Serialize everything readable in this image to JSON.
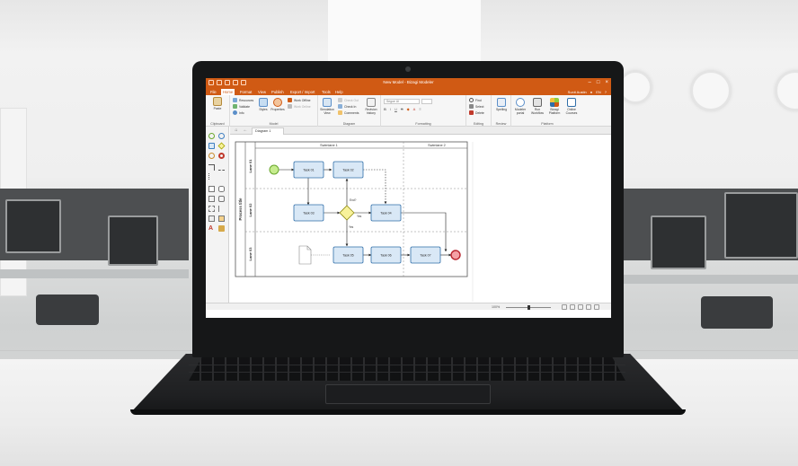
{
  "window": {
    "title": "New Model - Bizagi Modeler"
  },
  "menu": {
    "items": [
      "File",
      "Home",
      "Format",
      "View",
      "Publish",
      "Export / Import",
      "Tools",
      "Help"
    ],
    "active": "Home",
    "user": "Sunit Austin",
    "lang": "EN"
  },
  "ribbon": {
    "clipboard": {
      "paste": "Paste",
      "label": "Clipboard"
    },
    "model": {
      "resources": "Resources",
      "validate": "Validate",
      "info": "Info",
      "styles": "Styles",
      "properties": "Properties",
      "work_offline": "Work Offline",
      "work_online": "Work Online",
      "label": "Model"
    },
    "diagram": {
      "simulation_view": "Simulation View",
      "check_out": "Check Out",
      "check_in": "Check In",
      "comments": "Comments",
      "revision_history": "Revision history",
      "label": "Diagram"
    },
    "formatting": {
      "font": "Segoe UI",
      "label": "Formatting",
      "bold": "B",
      "italic": "I",
      "underline": "U",
      "strike": "S"
    },
    "editing": {
      "find": "Find",
      "select": "Select",
      "delete": "Delete",
      "label": "Editing"
    },
    "review": {
      "spelling": "Spelling",
      "label": "Review"
    },
    "platform": {
      "modeler_portal": "Modeler portal",
      "run_workflow": "Run Workflow",
      "bizagi_platform": "Bizagi Platform",
      "online_courses": "Online Courses",
      "label": "Platform"
    }
  },
  "tabs": {
    "diagram": "Diagram 1"
  },
  "diagram": {
    "pool": "Process title",
    "swimlanes": [
      "Swimlane 1",
      "Swimlane 2"
    ],
    "lanes": [
      "Lane 01",
      "Lane 02",
      "Lane 03"
    ],
    "tasks": {
      "t1": "Task 01",
      "t2": "Task 02",
      "t3": "Task 03",
      "t4": "Task 04",
      "t5": "Task 05",
      "t6": "Task 06",
      "t7": "Task 07"
    },
    "gateway_labels": {
      "question": "End?",
      "yes1": "Yes",
      "yes2": "Yes"
    }
  },
  "status": {
    "zoom": "100%"
  },
  "colors": {
    "accent": "#d05a14",
    "task_fill": "#d9e8f6",
    "task_stroke": "#2f6ea8",
    "start": "#8fcd3e",
    "end": "#e2474f",
    "gateway": "#f8f29a"
  }
}
